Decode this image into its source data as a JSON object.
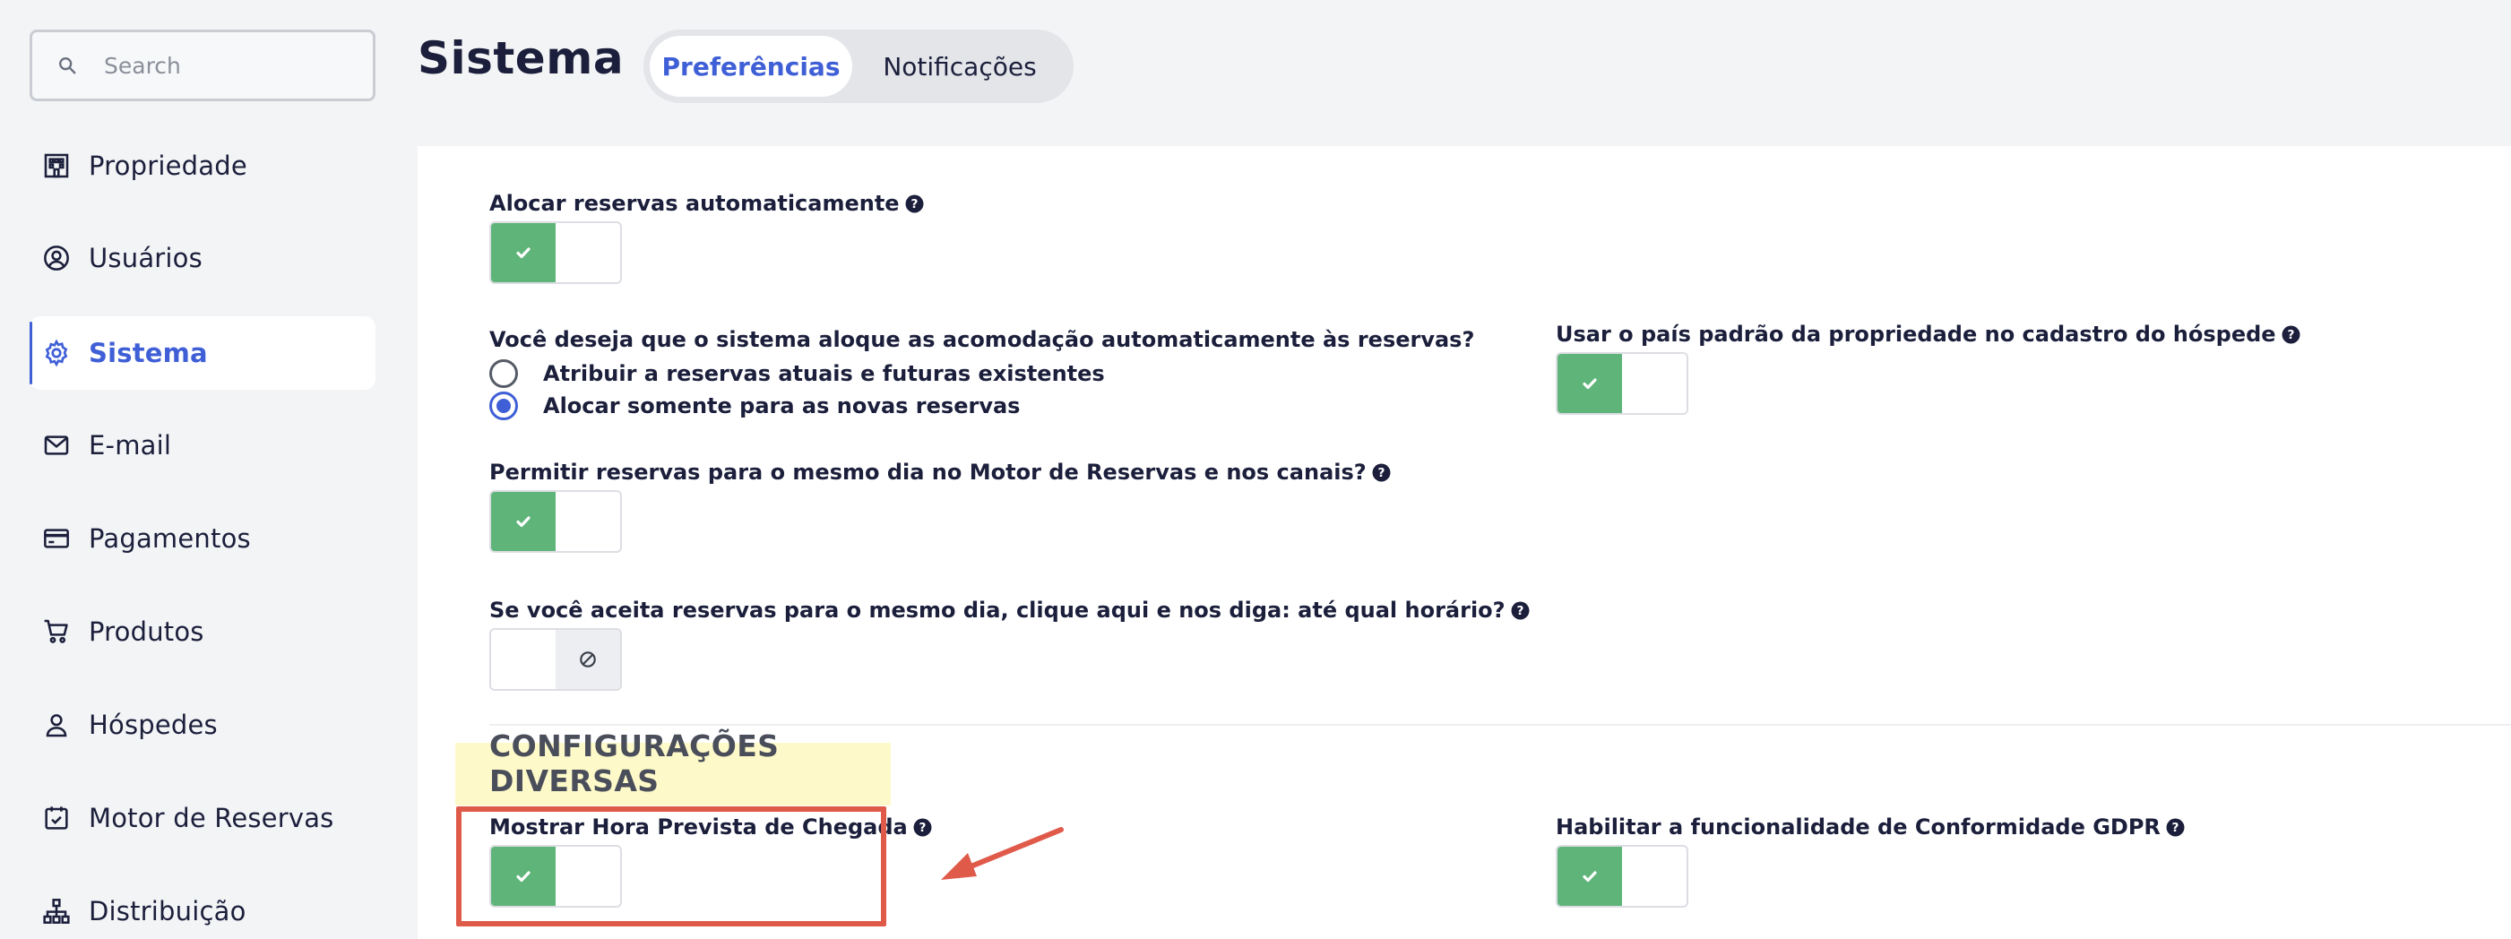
{
  "search": {
    "placeholder": "Search"
  },
  "sidebar": {
    "items": [
      {
        "label": "Propriedade"
      },
      {
        "label": "Usuários"
      },
      {
        "label": "Sistema"
      },
      {
        "label": "E-mail"
      },
      {
        "label": "Pagamentos"
      },
      {
        "label": "Produtos"
      },
      {
        "label": "Hóspedes"
      },
      {
        "label": "Motor de Reservas"
      },
      {
        "label": "Distribuição"
      }
    ],
    "active_index": 2
  },
  "header": {
    "title": "Sistema",
    "tabs": [
      {
        "label": "Preferências",
        "active": true
      },
      {
        "label": "Notificações",
        "active": false
      }
    ]
  },
  "settings": {
    "auto_allocate": {
      "label": "Alocar reservas automaticamente",
      "enabled": true
    },
    "allocation_question": {
      "label": "Você deseja que o sistema aloque as acomodação automaticamente às reservas?",
      "options": [
        {
          "label": "Atribuir a reservas atuais e futuras existentes",
          "selected": false
        },
        {
          "label": "Alocar somente para as novas reservas",
          "selected": true
        }
      ]
    },
    "same_day": {
      "label": "Permitir reservas para o mesmo dia no Motor de Reservas e nos canais?",
      "enabled": true
    },
    "same_day_time": {
      "label": "Se você aceita reservas para o mesmo dia, clique aqui e nos diga: até qual horário?",
      "enabled": false
    },
    "default_country": {
      "label": "Usar o país padrão da propriedade no cadastro do hóspede",
      "enabled": true
    },
    "section_title": "CONFIGURAÇÕES DIVERSAS",
    "arrival_time": {
      "label": "Mostrar Hora Prevista de Chegada",
      "enabled": true
    },
    "gdpr": {
      "label": "Habilitar a funcionalidade de Conformidade GDPR",
      "enabled": true
    }
  },
  "colors": {
    "accent": "#3f5fd6",
    "toggle_on": "#5fb47a",
    "annotation": "#e05a4a",
    "section_highlight": "#fdf9c9"
  }
}
